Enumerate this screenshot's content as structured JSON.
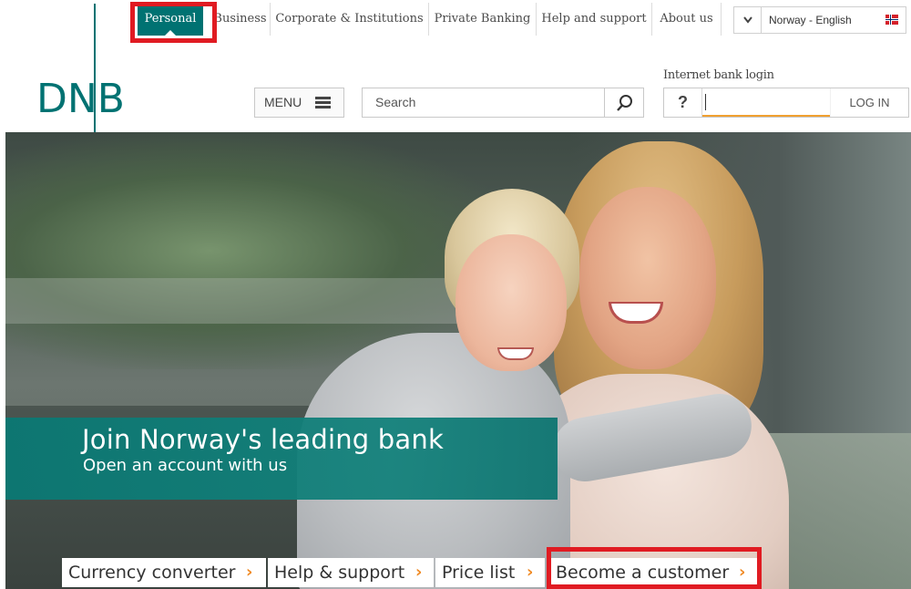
{
  "topnav": {
    "items": [
      "Personal",
      "Business",
      "Corporate & Institutions",
      "Private Banking",
      "Help and support",
      "About us"
    ],
    "active": "Personal",
    "language": "Norway - English"
  },
  "header": {
    "logo": "DNB",
    "menu_label": "MENU",
    "search_placeholder": "Search",
    "login_label": "Internet bank login",
    "help_label": "?",
    "login_button": "LOG IN"
  },
  "hero": {
    "title": "Join Norway's leading bank",
    "subtitle": "Open an account with us"
  },
  "quicklinks": [
    "Currency converter",
    "Help & support",
    "Price list",
    "Become a customer"
  ],
  "highlight_color": "#e01b22",
  "brand_color": "#007272",
  "accent_color": "#f08a24",
  "icons": [
    "search-icon",
    "menu-icon",
    "chevron-down-icon",
    "norway-flag-icon",
    "chevron-right-icon"
  ]
}
